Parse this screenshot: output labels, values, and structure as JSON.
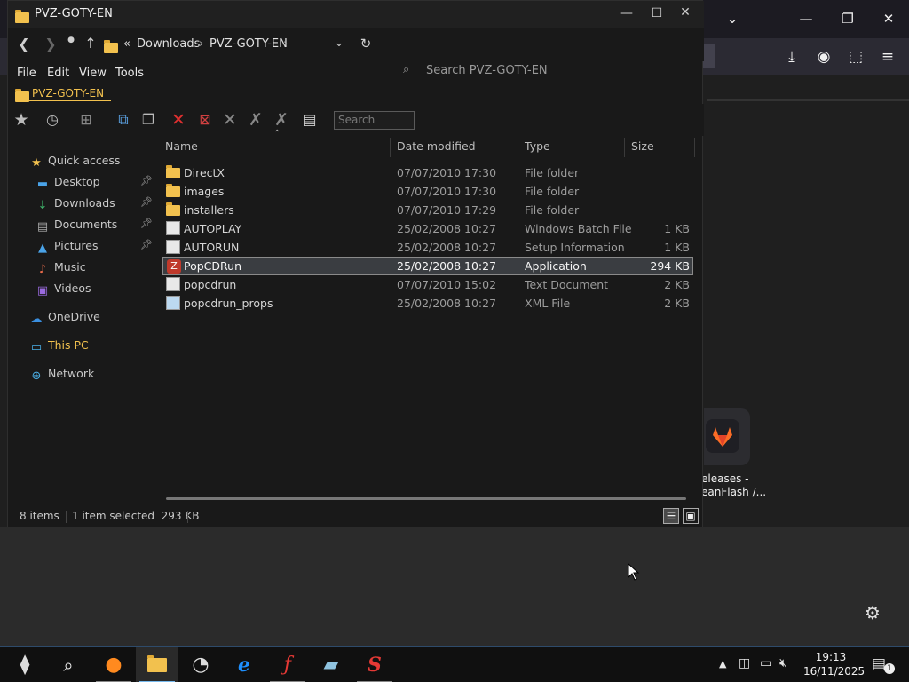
{
  "explorer": {
    "title": "PVZ-GOTY-EN",
    "breadcrumb": [
      "«",
      "Downloads",
      "PVZ-GOTY-EN"
    ],
    "search_placeholder": "Search PVZ-GOTY-EN",
    "menu": [
      "File",
      "Edit",
      "View",
      "Tools"
    ],
    "path_tab": "PVZ-GOTY-EN",
    "legacy_search_placeholder": "Search",
    "columns": [
      "Name",
      "Date modified",
      "Type",
      "Size"
    ],
    "files": [
      {
        "name": "DirectX",
        "date": "07/07/2010 17:30",
        "type": "File folder",
        "size": "",
        "icon": "folder-icon"
      },
      {
        "name": "images",
        "date": "07/07/2010 17:30",
        "type": "File folder",
        "size": "",
        "icon": "folder-icon"
      },
      {
        "name": "installers",
        "date": "07/07/2010 17:29",
        "type": "File folder",
        "size": "",
        "icon": "folder-icon"
      },
      {
        "name": "AUTOPLAY",
        "date": "25/02/2008 10:27",
        "type": "Windows Batch File",
        "size": "1 KB",
        "icon": "batch-file-icon"
      },
      {
        "name": "AUTORUN",
        "date": "25/02/2008 10:27",
        "type": "Setup Information",
        "size": "1 KB",
        "icon": "setup-info-icon"
      },
      {
        "name": "PopCDRun",
        "date": "25/02/2008 10:27",
        "type": "Application",
        "size": "294 KB",
        "icon": "popcap-app-icon"
      },
      {
        "name": "popcdrun",
        "date": "07/07/2010 15:02",
        "type": "Text Document",
        "size": "2 KB",
        "icon": "text-document-icon"
      },
      {
        "name": "popcdrun_props",
        "date": "25/02/2008 10:27",
        "type": "XML File",
        "size": "2 KB",
        "icon": "xml-file-icon"
      }
    ],
    "selected_index": 5,
    "sidebar": [
      {
        "label": "Quick access",
        "icon": "star-icon",
        "pinned": false,
        "indent": 0
      },
      {
        "label": "Desktop",
        "icon": "desktop-icon",
        "pinned": true,
        "indent": 1
      },
      {
        "label": "Downloads",
        "icon": "download-icon",
        "pinned": true,
        "indent": 1
      },
      {
        "label": "Documents",
        "icon": "documents-icon",
        "pinned": true,
        "indent": 1
      },
      {
        "label": "Pictures",
        "icon": "pictures-icon",
        "pinned": true,
        "indent": 1
      },
      {
        "label": "Music",
        "icon": "music-icon",
        "pinned": false,
        "indent": 1
      },
      {
        "label": "Videos",
        "icon": "videos-icon",
        "pinned": false,
        "indent": 1
      },
      {
        "label": "OneDrive",
        "icon": "onedrive-icon",
        "pinned": false,
        "indent": 0
      },
      {
        "label": "This PC",
        "icon": "this-pc-icon",
        "pinned": false,
        "indent": 0
      },
      {
        "label": "Network",
        "icon": "network-icon",
        "pinned": false,
        "indent": 0
      }
    ],
    "status": {
      "items": "8 items",
      "selected": "1 item selected  293 KB"
    }
  },
  "browser_bg": {
    "tile_label": "eleases -\neanFlash /..."
  },
  "taskbar": {
    "apps": [
      "start-icon",
      "search-icon",
      "firefox-icon",
      "file-explorer-icon",
      "speedtest-icon",
      "internet-explorer-icon",
      "flash-icon",
      "notepad-icon",
      "red-s-app-icon"
    ],
    "time": "19:13",
    "date": "16/11/2025",
    "notification_count": "1"
  },
  "colors": {
    "accent": "#f2c14e",
    "selection": "#3a3d41",
    "taskbar_active": "#76b9ed"
  }
}
